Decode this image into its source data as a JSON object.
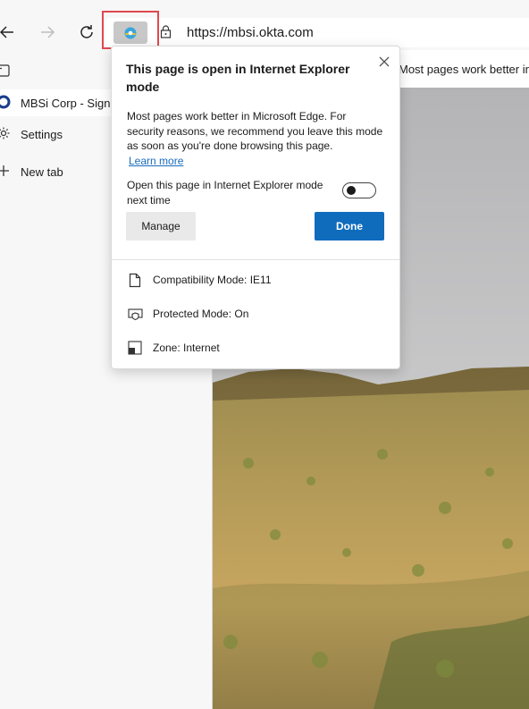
{
  "toolbar": {
    "back_icon": "back-arrow-icon",
    "forward_icon": "forward-arrow-icon",
    "refresh_icon": "refresh-icon",
    "ie_mode_icon": "internet-explorer-mode-icon",
    "lock_icon": "lock-icon",
    "url": "https://mbsi.okta.com",
    "highlight_color": "#e0494f"
  },
  "sidebar": {
    "items": [
      {
        "label": "",
        "icon": "tab-actions-icon"
      },
      {
        "label": "MBSi Corp - Sign In",
        "icon": "okta-favicon"
      },
      {
        "label": "Settings",
        "icon": "gear-icon"
      },
      {
        "label": "New tab",
        "icon": "plus-icon"
      }
    ]
  },
  "content": {
    "infobar_text": "Most pages work better in"
  },
  "flyout": {
    "title": "This page is open in Internet Explorer mode",
    "description": "Most pages work better in Microsoft Edge. For security reasons, we recommend you leave this mode as soon as you're done browsing this page.",
    "learn_more": "Learn more",
    "toggle_label": "Open this page in Internet Explorer mode next time",
    "toggle_state": "off",
    "manage_label": "Manage",
    "done_label": "Done",
    "done_color": "#0f6cbd",
    "info": [
      {
        "icon": "document-icon",
        "text": "Compatibility Mode: IE11"
      },
      {
        "icon": "shield-icon",
        "text": "Protected Mode: On"
      },
      {
        "icon": "zone-icon",
        "text": "Zone: Internet"
      }
    ]
  }
}
